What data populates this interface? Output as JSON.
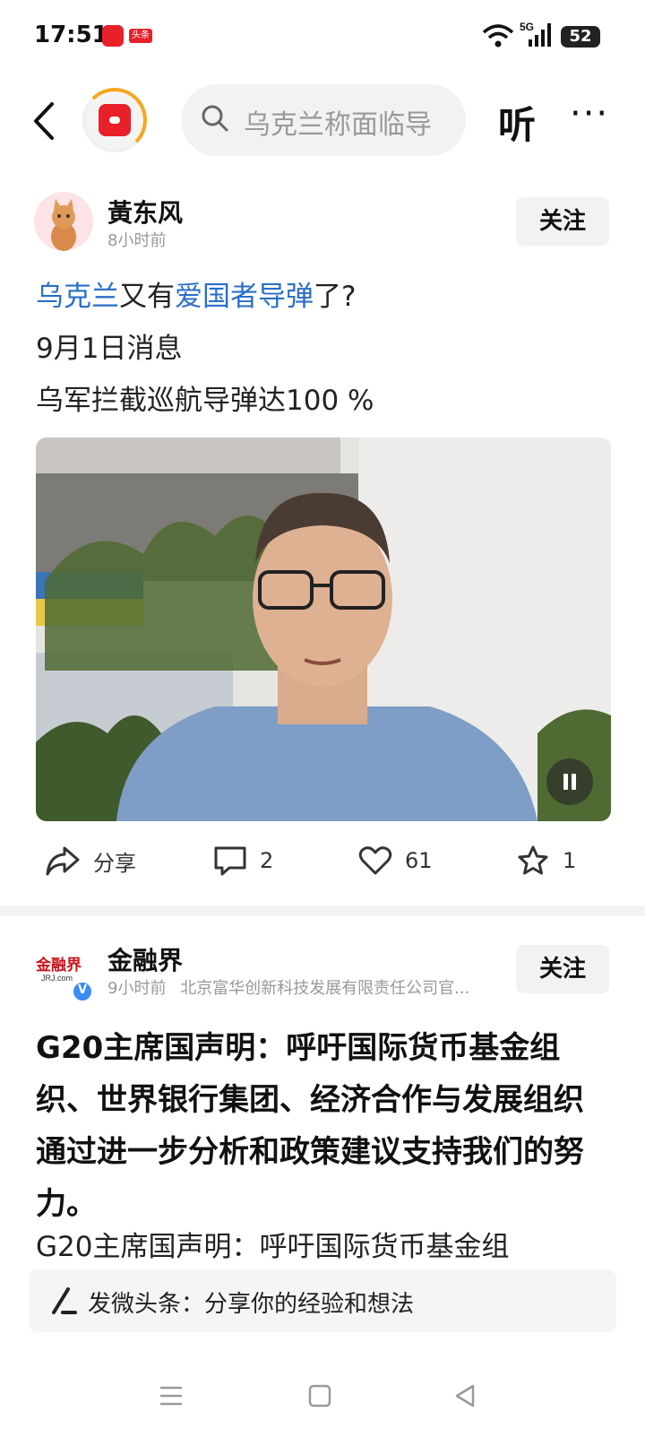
{
  "status_bar": {
    "time": "17:51",
    "app_badge": "头条",
    "network": "5G",
    "battery": "52"
  },
  "top_bar": {
    "search_placeholder": "乌克兰称面临导",
    "listen_label": "听",
    "more_label": "···"
  },
  "post1": {
    "author": "黃东风",
    "time": "8小时前",
    "follow_label": "关注",
    "title_parts": [
      "乌克兰",
      "又有",
      "爱国者导弹",
      "了?"
    ],
    "line2": "9月1日消息",
    "line3": "乌军拦截巡航导弹达100 %",
    "share_label": "分享",
    "comments": "2",
    "likes": "61",
    "favorites": "1"
  },
  "post2": {
    "author": "金融界",
    "logo_text": "金融界",
    "logo_sub": "JRJ.com",
    "time": "9小时前",
    "publisher": "北京富华创新科技发展有限责任公司官...",
    "follow_label": "关注",
    "headline": "G20主席国声明：呼吁国际货币基金组织、世界银行集团、经济合作与发展组织通过进一步分析和政策建议支持我们的努力。",
    "body_preview": "G20主席国声明：呼吁国际货币基金组"
  },
  "compose": {
    "placeholder": "发微头条：分享你的经验和想法"
  },
  "colors": {
    "accent_link": "#2a6fc7",
    "brand_red": "#e8202a",
    "verified_blue": "#3b8cf5"
  }
}
